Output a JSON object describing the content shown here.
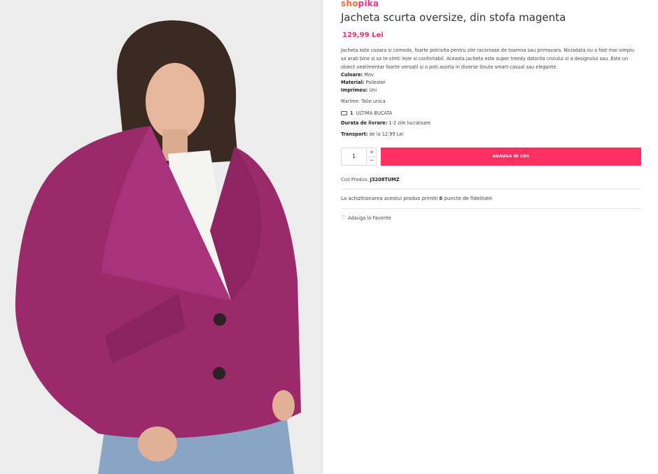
{
  "brand": {
    "part1": "sho",
    "part2": "pika"
  },
  "product": {
    "title": "Jacheta scurta oversize, din stofa magenta",
    "price": "129,99 Lei",
    "description": "Jacheta este usoara si comoda, foarte potrivita pentru zile racoroase de toamna sau primavara. Niciodata nu a fost mai simplu sa arati bine si sa te simti lejer si confortabil. Aceasta jacheta este super trendy datorita croiului si a designului sau. Este un obiect vestimentar foarte versatil si o poti asorta in diverse tinute smart-casual sau elegante.",
    "attributes": {
      "color_label": "Culoare:",
      "color_value": "Mov",
      "material_label": "Material:",
      "material_value": "Poliester",
      "print_label": "Imprimeu:",
      "print_value": "Uni"
    },
    "size_text": "Marime: Talie unica",
    "stock_count": "1",
    "stock_text": "ULTIMA BUCATA",
    "delivery_label": "Durata de livrare:",
    "delivery_value": "1-2 zile lucratoare",
    "transport_label": "Transport:",
    "transport_value": "de la 12.99 Lei",
    "quantity": "1",
    "qty_up": "+",
    "qty_down": "−",
    "add_to_cart": "ADAUGA IN COS",
    "code_label": "Cod Produs:",
    "code_value": "J3208TUMZ",
    "points_pre": "La achizitionarea acestui produs primiti",
    "points_value": "6",
    "points_post": "puncte de fidelitate",
    "favorite": "Adauga la Favorite"
  },
  "colors": {
    "accent": "#ff2e63",
    "price": "#e0336b",
    "jacket": "#9b2a6b"
  },
  "icons": {
    "stock": "truck-icon",
    "favorite": "heart-icon"
  }
}
